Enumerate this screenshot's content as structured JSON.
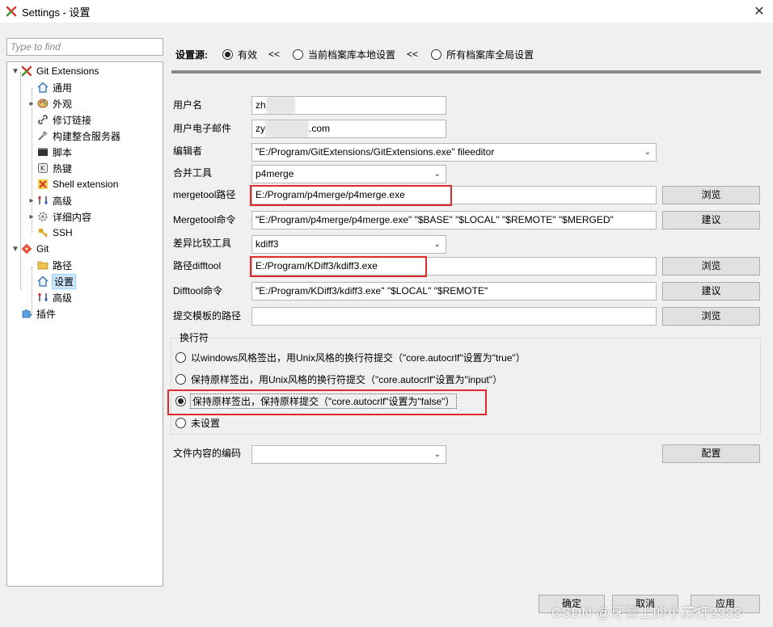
{
  "window": {
    "title": "Settings - 设置",
    "close_glyph": "✕"
  },
  "search": {
    "placeholder": "Type to find"
  },
  "tree": {
    "git_extensions": "Git Extensions",
    "general": "通用",
    "appearance": "外观",
    "revision_links": "修订链接",
    "build_server": "构建整合服务器",
    "scripts": "脚本",
    "hotkeys": "热键",
    "shell_extension": "Shell extension",
    "advanced1": "高级",
    "detailed": "详细内容",
    "ssh": "SSH",
    "git": "Git",
    "paths": "路径",
    "config": "设置",
    "advanced2": "高级",
    "plugins": "插件"
  },
  "source": {
    "label": "设置源:",
    "options": [
      "有效",
      "当前档案库本地设置",
      "所有档案库全局设置"
    ],
    "sep": "<<",
    "selected": 0
  },
  "fields": {
    "username_label": "用户名",
    "username_value": "zh",
    "email_label": "用户电子邮件",
    "email_value_pre": "zy",
    "email_value_post": ".com",
    "editor_label": "编辑者",
    "editor_value": "\"E:/Program/GitExtensions/GitExtensions.exe\" fileeditor",
    "mergetool_label": "合并工具",
    "mergetool_value": "p4merge",
    "mergetool_path_label": "mergetool路径",
    "mergetool_path_value": "E:/Program/p4merge/p4merge.exe",
    "mergetool_cmd_label": "Mergetool命令",
    "mergetool_cmd_value": "\"E:/Program/p4merge/p4merge.exe\" \"$BASE\" \"$LOCAL\" \"$REMOTE\" \"$MERGED\"",
    "difftool_label": "差异比较工具",
    "difftool_value": "kdiff3",
    "difftool_path_label": "路径difftool",
    "difftool_path_value": "E:/Program/KDiff3/kdiff3.exe",
    "difftool_cmd_label": "Difftool命令",
    "difftool_cmd_value": "\"E:/Program/KDiff3/kdiff3.exe\" \"$LOCAL\" \"$REMOTE\"",
    "commit_template_label": "提交模板的路径",
    "commit_template_value": "",
    "encoding_label": "文件内容的编码",
    "encoding_value": ""
  },
  "buttons": {
    "browse": "浏览",
    "suggest": "建议",
    "configure": "配置",
    "ok": "确定",
    "cancel": "取消",
    "apply": "应用"
  },
  "line_endings": {
    "title": "换行符",
    "options": [
      "以windows风格签出，用Unix风格的换行符提交（\"core.autocrlf\"设置为\"true\"）",
      "保持原样签出，用Unix风格的换行符提交（\"core.autocrlf\"设置为\"input\"）",
      "保持原样签出，保持原样提交（\"core.autocrlf\"设置为\"false\"）",
      "未设置"
    ],
    "selected": 2
  },
  "watermark": "CSDN @牙膏上的小苏打2333",
  "colors": {
    "highlight_red": "#e02a2a",
    "selection_blue": "#cce8ff"
  }
}
